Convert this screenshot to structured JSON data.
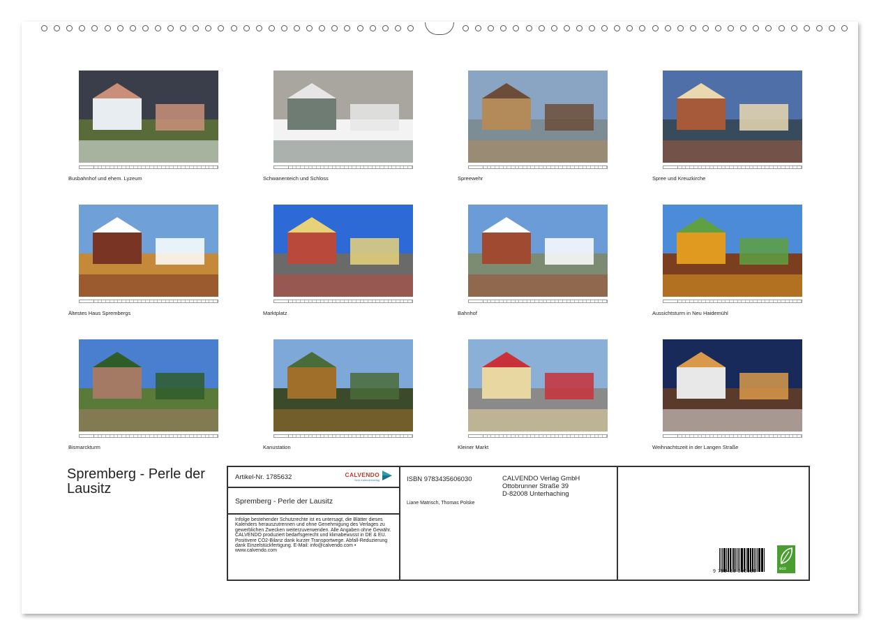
{
  "photos": [
    {
      "caption": "Busbahnhof und ehem. Lyzeum",
      "month": "Januar"
    },
    {
      "caption": "Schwanenteich und Schloss",
      "month": "Februar"
    },
    {
      "caption": "Spreewehr",
      "month": "März"
    },
    {
      "caption": "Spree und Kreuzkirche",
      "month": "April"
    },
    {
      "caption": "Ältestes Haus Sprembergs",
      "month": "Mai"
    },
    {
      "caption": "Marktplatz",
      "month": "Juni"
    },
    {
      "caption": "Bahnhof",
      "month": "Juli"
    },
    {
      "caption": "Aussichtsturm in Neu Haidemühl",
      "month": "August"
    },
    {
      "caption": "Bismarckturm",
      "month": "September"
    },
    {
      "caption": "Kanustation",
      "month": "Oktober"
    },
    {
      "caption": "Kleiner Markt",
      "month": "November"
    },
    {
      "caption": "Weihnachtszeit in der Langen Straße",
      "month": "Dezember"
    }
  ],
  "title": "Spremberg - Perle der Lausitz",
  "info": {
    "article": "Artikel-Nr. 1785632",
    "brand": "CALVENDO",
    "brand_sub": "Sein Kalenderverlag",
    "subtitle": "Spremberg - Perle der Lausitz",
    "legal": "Infolge bestehender Schutzrechte ist es untersagt, die Blätter dieses Kalenders herauszutrennen und ohne Genehmigung des Verlages zu gewerblichen Zwecken weiterzuverwenden. Alle Angaben ohne Gewähr. CALVENDO produziert bedarfsgerecht und klimabewusst in DE & EU. Positivere CO2-Bilanz dank kurzer Transportwege. Abfall-Reduzierung dank Einzelstückfertigung. E-Mail: info@calvendo.com • www.calvendo.com",
    "isbn": "ISBN 9783435606030",
    "authors": "Liane Matrisch, Thomas Polske",
    "publisher": "CALVENDO Verlag GmbH",
    "street": "Ottobrunner Straße 39",
    "city": "D-82008 Unterhaching",
    "barcode_number": "9 783435 606030",
    "eco_label": "eco"
  }
}
